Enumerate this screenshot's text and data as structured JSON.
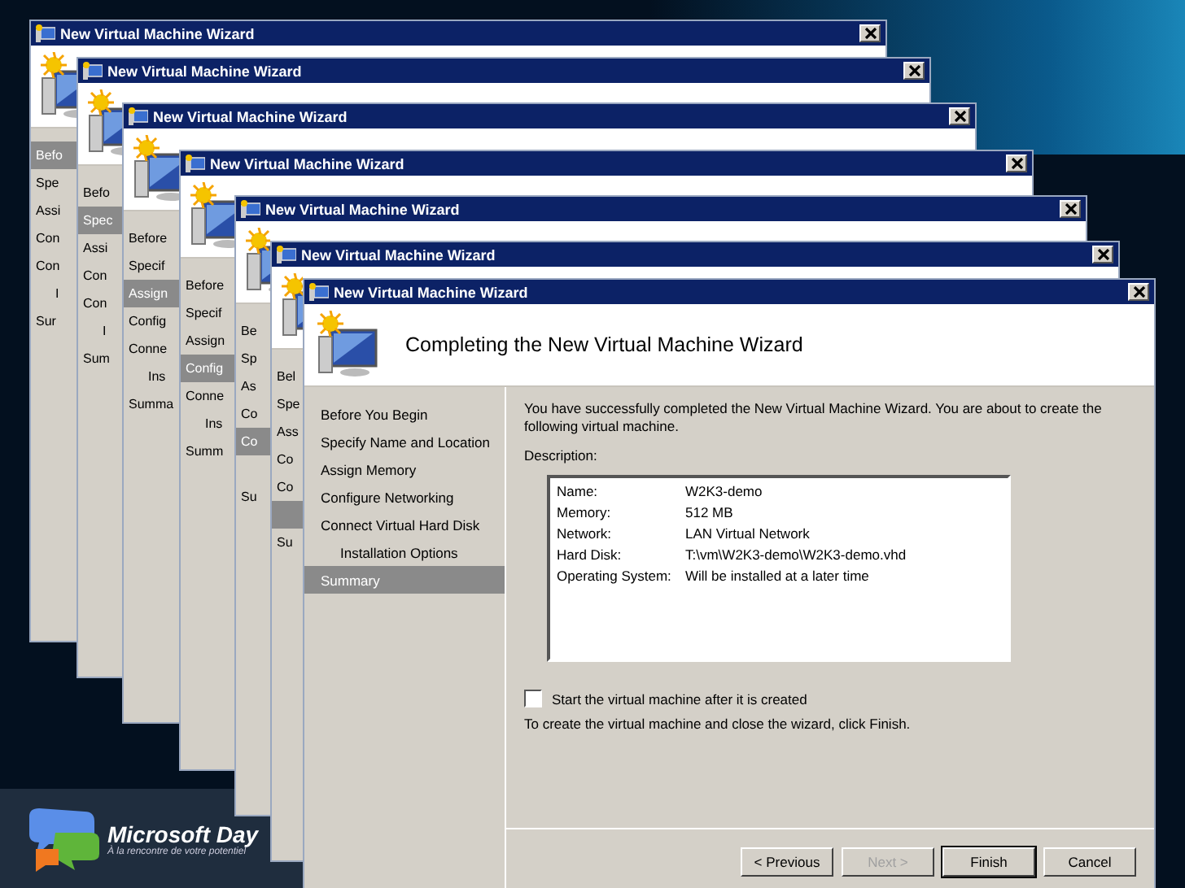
{
  "background_windows": [
    {
      "title": "New Virtual Machine Wizard",
      "nav": [
        {
          "label": "Befo",
          "selected": true
        },
        {
          "label": "Spe",
          "selected": false
        },
        {
          "label": "Assi",
          "selected": false
        },
        {
          "label": "Con",
          "selected": false
        },
        {
          "label": "Con",
          "selected": false,
          "children": [
            {
              "label": "I",
              "selected": false
            }
          ]
        },
        {
          "label": "Sur",
          "selected": false
        }
      ]
    },
    {
      "title": "New Virtual Machine Wizard",
      "nav": [
        {
          "label": "Befo",
          "selected": false
        },
        {
          "label": "Spec",
          "selected": true
        },
        {
          "label": "Assi",
          "selected": false
        },
        {
          "label": "Con",
          "selected": false
        },
        {
          "label": "Con",
          "selected": false,
          "children": [
            {
              "label": "I",
              "selected": false
            }
          ]
        },
        {
          "label": "Sum",
          "selected": false
        }
      ]
    },
    {
      "title": "New Virtual Machine Wizard",
      "nav": [
        {
          "label": "Before",
          "selected": false
        },
        {
          "label": "Specif",
          "selected": false
        },
        {
          "label": "Assign",
          "selected": true
        },
        {
          "label": "Config",
          "selected": false
        },
        {
          "label": "Conne",
          "selected": false,
          "children": [
            {
              "label": "Ins",
              "selected": false
            }
          ]
        },
        {
          "label": "Summa",
          "selected": false
        }
      ]
    },
    {
      "title": "New Virtual Machine Wizard",
      "nav": [
        {
          "label": "Before",
          "selected": false
        },
        {
          "label": "Specif",
          "selected": false
        },
        {
          "label": "Assign",
          "selected": false
        },
        {
          "label": "Config",
          "selected": true
        },
        {
          "label": "Conne",
          "selected": false,
          "children": [
            {
              "label": "Ins",
              "selected": false
            }
          ]
        },
        {
          "label": "Summ",
          "selected": false
        }
      ]
    },
    {
      "title": "New Virtual Machine Wizard",
      "nav": [
        {
          "label": "Be",
          "selected": false
        },
        {
          "label": "Sp",
          "selected": false
        },
        {
          "label": "As",
          "selected": false
        },
        {
          "label": "Co",
          "selected": false
        },
        {
          "label": "Co",
          "selected": true
        },
        {
          "label": "Su",
          "selected": false
        }
      ]
    },
    {
      "title": "New Virtual Machine Wizard",
      "nav": [
        {
          "label": "Bel",
          "selected": false
        },
        {
          "label": "Spe",
          "selected": false
        },
        {
          "label": "Ass",
          "selected": false
        },
        {
          "label": "Co",
          "selected": false
        },
        {
          "label": "Co",
          "selected": false,
          "children": [
            {
              "selected": true
            }
          ]
        },
        {
          "label": "Su",
          "selected": false
        }
      ]
    }
  ],
  "wizard": {
    "title": "New Virtual Machine Wizard",
    "heading": "Completing the New Virtual Machine Wizard",
    "nav": [
      {
        "label": "Before You Begin",
        "selected": false
      },
      {
        "label": "Specify Name and Location",
        "selected": false
      },
      {
        "label": "Assign Memory",
        "selected": false
      },
      {
        "label": "Configure Networking",
        "selected": false
      },
      {
        "label": "Connect Virtual Hard Disk",
        "selected": false,
        "children": [
          {
            "label": "Installation Options",
            "selected": false
          }
        ]
      },
      {
        "label": "Summary",
        "selected": true
      }
    ],
    "intro": "You have successfully completed the New Virtual Machine Wizard. You are about to create the following virtual machine.",
    "description_label": "Description:",
    "details": [
      {
        "label": "Name:",
        "value": "W2K3-demo"
      },
      {
        "label": "Memory:",
        "value": "512 MB"
      },
      {
        "label": "Network:",
        "value": "LAN Virtual Network"
      },
      {
        "label": "Hard Disk:",
        "value": "T:\\vm\\W2K3-demo\\W2K3-demo.vhd"
      },
      {
        "label": "Operating System:",
        "value": "Will be installed at a later time"
      }
    ],
    "start_checkbox": {
      "label": "Start the virtual machine after it is created",
      "checked": false
    },
    "hint": "To create the virtual machine and close the wizard, click Finish.",
    "buttons": [
      {
        "label": "< Previous",
        "disabled": false,
        "default": false
      },
      {
        "label": "Next >",
        "disabled": true,
        "default": false
      },
      {
        "label": "Finish",
        "disabled": false,
        "default": true
      },
      {
        "label": "Cancel",
        "disabled": false,
        "default": false
      }
    ]
  },
  "branding": {
    "logo": "Microsoft Day",
    "tagline": "À la rencontre de votre potentiel"
  }
}
